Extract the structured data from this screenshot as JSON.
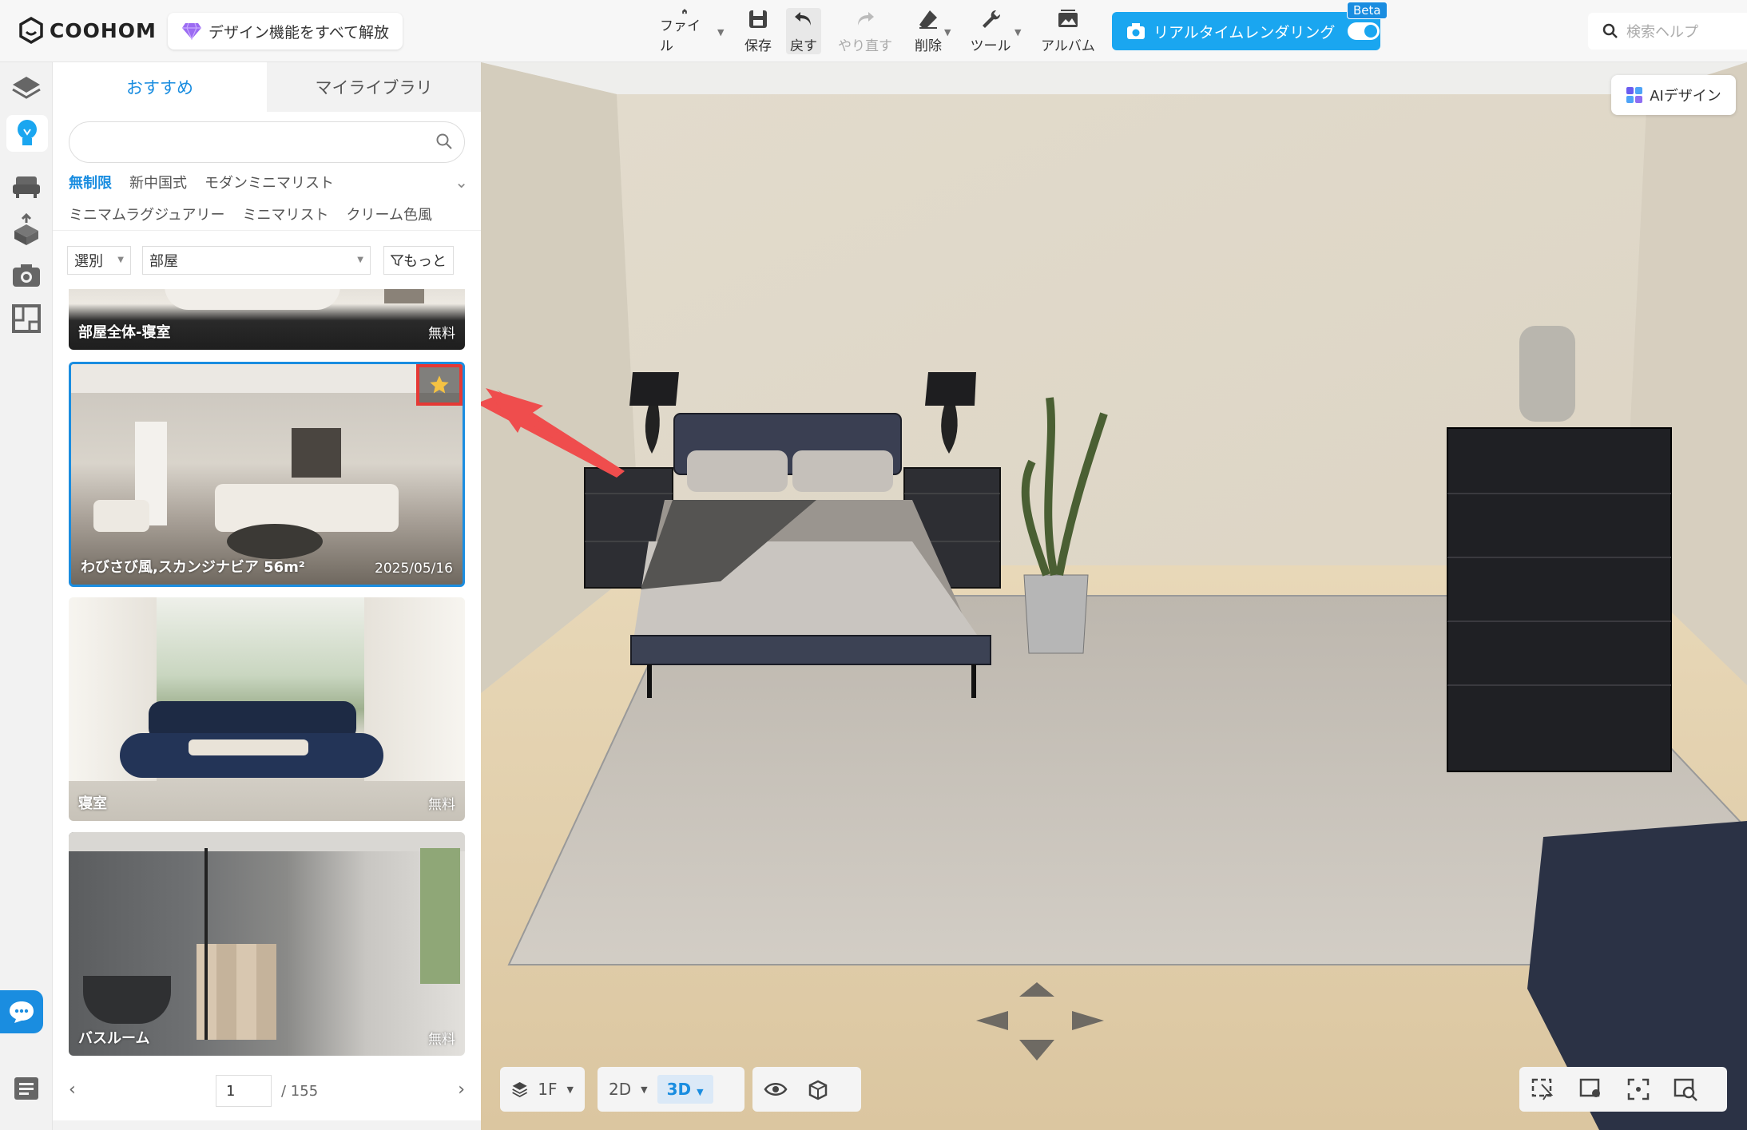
{
  "app": {
    "logo_text": "COOHOM",
    "unlock_label": "デザイン機能をすべて解放"
  },
  "toolbar": {
    "file": "ファイル",
    "save": "保存",
    "undo": "戻す",
    "redo": "やり直す",
    "delete": "削除",
    "tools": "ツール",
    "album": "アルバム",
    "render_label": "リアルタイムレンダリング",
    "beta": "Beta",
    "help_placeholder": "検索ヘルプ"
  },
  "panel": {
    "tabs": [
      "おすすめ",
      "マイライブラリ"
    ],
    "search_placeholder": "",
    "styles_row1": [
      "無制限",
      "新中国式",
      "モダンミニマリスト"
    ],
    "styles_row2": [
      "ミニマムラグジュアリー",
      "ミニマリスト",
      "クリーム色風"
    ],
    "filter_select": "選別",
    "filter_room": "部屋",
    "filter_more": "もっと",
    "cards": [
      {
        "caption": "部屋全体-寝室",
        "tag": "無料"
      },
      {
        "caption": "わびさび風,スカンジナビア 56m²",
        "tag": "2025/05/16"
      },
      {
        "caption": "寝室",
        "tag": "無料"
      },
      {
        "caption": "バスルーム",
        "tag": "無料"
      }
    ],
    "page_current": "1",
    "page_total": "/ 155"
  },
  "viewport": {
    "ai_label": "AIデザイン",
    "floor": "1F",
    "view_2d": "2D",
    "view_3d": "3D"
  },
  "colors": {
    "accent": "#1a8de0",
    "render_btn": "#1aa6f0",
    "highlight": "#e53935"
  }
}
